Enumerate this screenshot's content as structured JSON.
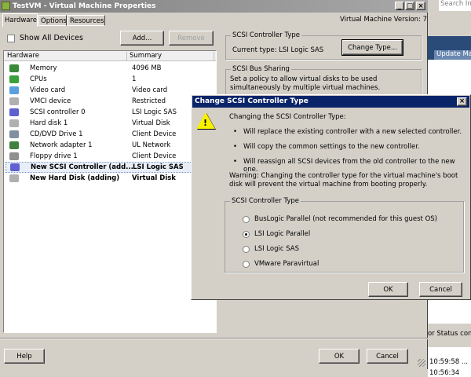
{
  "window": {
    "title": "TestVM - Virtual Machine Properties",
    "version": "Virtual Machine Version: 7"
  },
  "tabs": [
    {
      "label": "Hardware"
    },
    {
      "label": "Options"
    },
    {
      "label": "Resources"
    }
  ],
  "show_all_devices": {
    "label": "Show All Devices",
    "checked": false
  },
  "buttons": {
    "add": "Add...",
    "remove": "Remove",
    "help": "Help",
    "ok": "OK",
    "cancel": "Cancel",
    "change_type": "Change Type..."
  },
  "hardware_list": {
    "columns": [
      "Hardware",
      "Summary"
    ],
    "rows": [
      {
        "name": "Memory",
        "summary": "4096 MB",
        "icon": "memory-icon",
        "color": "#3a8a3a"
      },
      {
        "name": "CPUs",
        "summary": "1",
        "icon": "cpu-icon",
        "color": "#3aa03a"
      },
      {
        "name": "Video card",
        "summary": "Video card",
        "icon": "monitor-icon",
        "color": "#5aa0e0"
      },
      {
        "name": "VMCI device",
        "summary": "Restricted",
        "icon": "device-icon",
        "color": "#b0b0b0"
      },
      {
        "name": "SCSI controller 0",
        "summary": "LSI Logic SAS",
        "icon": "scsi-icon",
        "color": "#6060d0"
      },
      {
        "name": "Hard disk 1",
        "summary": "Virtual Disk",
        "icon": "disk-icon",
        "color": "#b0b0b0"
      },
      {
        "name": "CD/DVD Drive 1",
        "summary": "Client Device",
        "icon": "cdrom-icon",
        "color": "#8090a0"
      },
      {
        "name": "Network adapter 1",
        "summary": "UL Network",
        "icon": "network-icon",
        "color": "#408040"
      },
      {
        "name": "Floppy drive 1",
        "summary": "Client Device",
        "icon": "floppy-icon",
        "color": "#909090"
      },
      {
        "name": "New SCSI Controller (add...",
        "summary": "LSI Logic SAS",
        "icon": "scsi-icon",
        "color": "#6060d0",
        "bold": true,
        "selected": true
      },
      {
        "name": "New Hard Disk (adding)",
        "summary": "Virtual Disk",
        "icon": "disk-icon",
        "color": "#b0b0b0",
        "bold": true
      }
    ]
  },
  "scsi_type": {
    "legend": "SCSI Controller Type",
    "current": "Current type:  LSI Logic SAS"
  },
  "bus_sharing": {
    "legend": "SCSI Bus Sharing",
    "text": "Set a policy to allow virtual disks to be used simultaneously by multiple virtual machines."
  },
  "dialog": {
    "title": "Change SCSI Controller Type",
    "intro": "Changing the SCSI Controller Type:",
    "bullets": [
      "Will replace the existing controller with a new selected controller.",
      "Will copy the common settings to the new controller.",
      "Will reassign all SCSI devices from the old controller to the new one."
    ],
    "warning": "Warning: Changing the controller type for the virtual machine's boot disk will prevent the virtual machine from booting properly.",
    "group_legend": "SCSI Controller Type",
    "options": [
      {
        "label": "BusLogic Parallel (not recommended for this guest OS)",
        "selected": false
      },
      {
        "label": "LSI Logic Parallel",
        "selected": true
      },
      {
        "label": "LSI Logic SAS",
        "selected": false
      },
      {
        "label": "VMware Paravirtual",
        "selected": false
      }
    ],
    "ok": "OK",
    "cancel": "Cancel"
  },
  "background": {
    "search_placeholder": "Search Inv",
    "tab": "Update Man",
    "status": "or Status conta",
    "times": [
      "10:59:58 ...",
      "10:56:34"
    ]
  }
}
